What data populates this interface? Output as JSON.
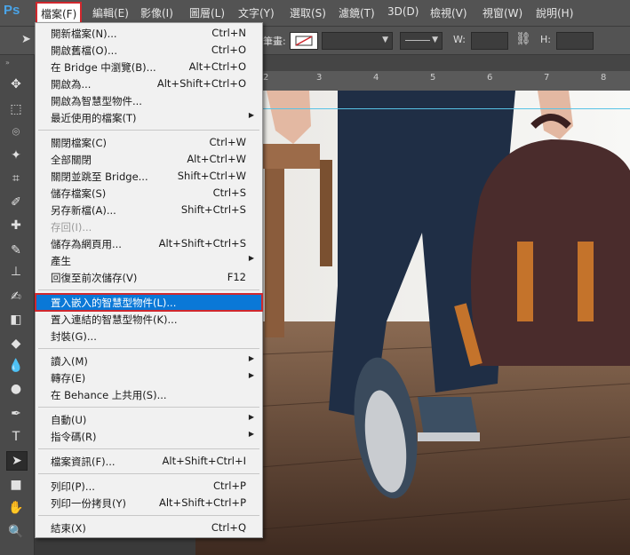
{
  "app": {
    "logo": "Ps"
  },
  "menubar": [
    {
      "label": "檔案(F)",
      "active": true
    },
    {
      "label": "編輯(E)"
    },
    {
      "label": "影像(I)"
    },
    {
      "label": "圖層(L)"
    },
    {
      "label": "文字(Y)"
    },
    {
      "label": "選取(S)"
    },
    {
      "label": "濾鏡(T)"
    },
    {
      "label": "3D(D)"
    },
    {
      "label": "檢視(V)"
    },
    {
      "label": "視窗(W)"
    },
    {
      "label": "說明(H)"
    }
  ],
  "options": {
    "stroke_label": "筆畫:",
    "w_label": "W:",
    "h_label": "H:",
    "link_icon": "link-icon"
  },
  "ruler": {
    "numbers": [
      "2",
      "3",
      "4",
      "5",
      "6",
      "7",
      "8"
    ]
  },
  "file_menu": {
    "items": [
      {
        "label": "開新檔案(N)...",
        "shortcut": "Ctrl+N"
      },
      {
        "label": "開啟舊檔(O)...",
        "shortcut": "Ctrl+O"
      },
      {
        "label": "在 Bridge 中瀏覽(B)...",
        "shortcut": "Alt+Ctrl+O"
      },
      {
        "label": "開啟為...",
        "shortcut": "Alt+Shift+Ctrl+O"
      },
      {
        "label": "開啟為智慧型物件..."
      },
      {
        "label": "最近使用的檔案(T)",
        "submenu": true
      },
      {
        "sep": true
      },
      {
        "label": "關閉檔案(C)",
        "shortcut": "Ctrl+W"
      },
      {
        "label": "全部關閉",
        "shortcut": "Alt+Ctrl+W"
      },
      {
        "label": "關閉並跳至 Bridge...",
        "shortcut": "Shift+Ctrl+W"
      },
      {
        "label": "儲存檔案(S)",
        "shortcut": "Ctrl+S"
      },
      {
        "label": "另存新檔(A)...",
        "shortcut": "Shift+Ctrl+S"
      },
      {
        "label": "存回(I)...",
        "disabled": true
      },
      {
        "label": "儲存為網頁用...",
        "shortcut": "Alt+Shift+Ctrl+S"
      },
      {
        "label": "產生",
        "submenu": true
      },
      {
        "label": "回復至前次儲存(V)",
        "shortcut": "F12"
      },
      {
        "sep": true
      },
      {
        "label": "置入嵌入的智慧型物件(L)...",
        "highlighted": true
      },
      {
        "label": "置入連結的智慧型物件(K)..."
      },
      {
        "label": "封裝(G)..."
      },
      {
        "sep": true
      },
      {
        "label": "讀入(M)",
        "submenu": true
      },
      {
        "label": "轉存(E)",
        "submenu": true
      },
      {
        "label": "在 Behance 上共用(S)..."
      },
      {
        "sep": true
      },
      {
        "label": "自動(U)",
        "submenu": true
      },
      {
        "label": "指令碼(R)",
        "submenu": true
      },
      {
        "sep": true
      },
      {
        "label": "檔案資訊(F)...",
        "shortcut": "Alt+Shift+Ctrl+I"
      },
      {
        "sep": true
      },
      {
        "label": "列印(P)...",
        "shortcut": "Ctrl+P"
      },
      {
        "label": "列印一份拷貝(Y)",
        "shortcut": "Alt+Shift+Ctrl+P"
      },
      {
        "sep": true
      },
      {
        "label": "結束(X)",
        "shortcut": "Ctrl+Q"
      }
    ]
  },
  "tools": [
    "move-tool-icon",
    "marquee-tool-icon",
    "lasso-tool-icon",
    "magic-wand-tool-icon",
    "crop-tool-icon",
    "eyedropper-tool-icon",
    "healing-brush-tool-icon",
    "brush-tool-icon",
    "clone-stamp-tool-icon",
    "history-brush-tool-icon",
    "eraser-tool-icon",
    "paint-bucket-tool-icon",
    "blur-tool-icon",
    "dodge-tool-icon",
    "pen-tool-icon",
    "type-tool-icon",
    "path-selection-tool-icon",
    "rectangle-tool-icon",
    "hand-tool-icon",
    "zoom-tool-icon"
  ],
  "colors": {
    "highlight": "#0a78d7",
    "annotation_red": "#d0282e",
    "ps_blue": "#4aa4e8"
  }
}
